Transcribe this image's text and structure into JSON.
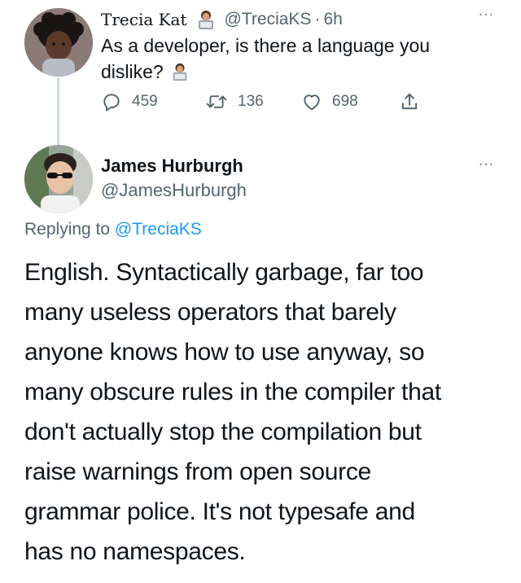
{
  "parent_tweet": {
    "author_name": "Trecia Kat",
    "author_handle": "@TreciaKS",
    "separator": "·",
    "time": "6h",
    "text": "As a developer, is there a language you dislike?",
    "name_emoji": "technologist-emoji",
    "text_emoji": "technologist-emoji",
    "actions": {
      "reply_count": "459",
      "retweet_count": "136",
      "like_count": "698"
    }
  },
  "reply_tweet": {
    "author_name": "James Hurburgh",
    "author_handle": "@JamesHurburgh",
    "replying_prefix": "Replying to",
    "replying_mention": "@TreciaKS",
    "text": "English.  Syntactically garbage, far too\nmany useless operators that barely\nanyone knows how to use anyway, so\nmany obscure rules in the compiler that\ndon't actually stop the compilation but\nraise warnings from open source\ngrammar police.  It's not typesafe and\nhas no namespaces."
  },
  "colors": {
    "text_primary": "#0f1419",
    "text_secondary": "#536471",
    "link": "#1d9bf0",
    "thread_line": "#cfd9de",
    "icon_gray": "#536471"
  },
  "icons": {
    "more": "more-horizontal-icon",
    "reply": "reply-icon",
    "retweet": "retweet-icon",
    "like": "heart-icon",
    "share": "share-icon"
  }
}
